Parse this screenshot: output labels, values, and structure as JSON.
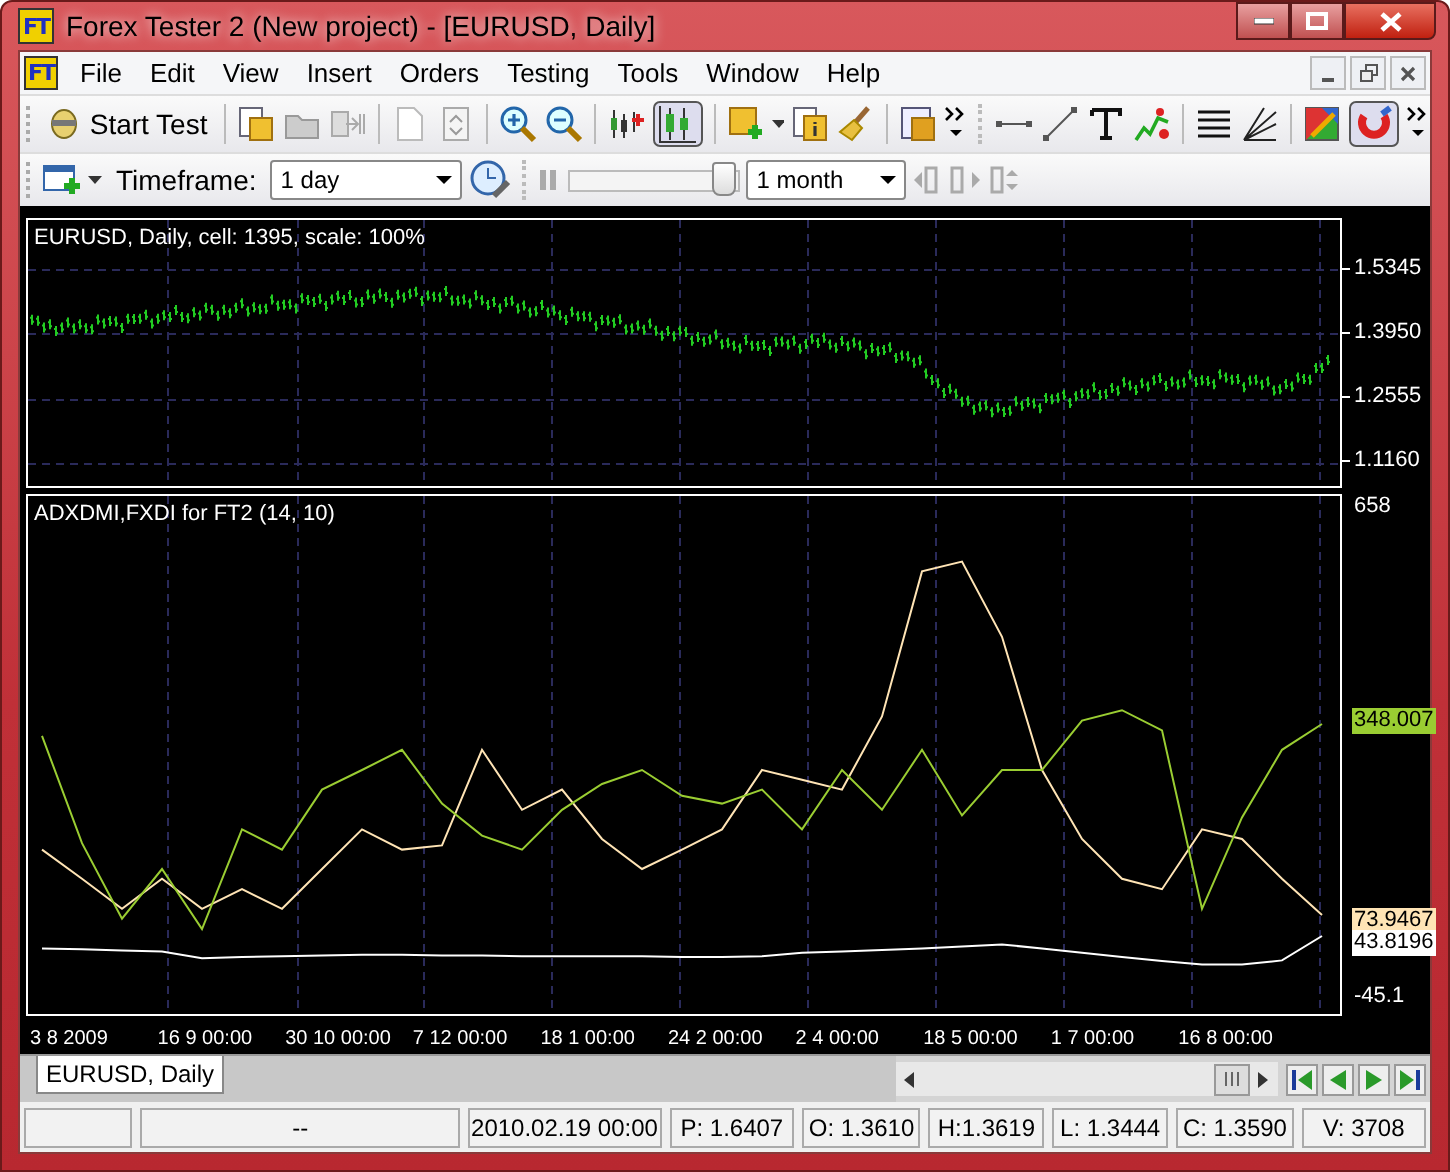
{
  "window": {
    "title": "Forex Tester 2  (New project) - [EURUSD, Daily]",
    "logo": "FT"
  },
  "menu_logo": "FT",
  "menu": [
    "File",
    "Edit",
    "View",
    "Insert",
    "Orders",
    "Testing",
    "Tools",
    "Window",
    "Help"
  ],
  "toolbar": {
    "start_test": "Start Test"
  },
  "timeframe_bar": {
    "label": "Timeframe:",
    "timeframe": "1 day",
    "speed": {
      "level": 0.97
    },
    "step": "1 month"
  },
  "price_chart": {
    "title": "EURUSD, Daily, cell: 1395, scale: 100%",
    "price_labels": [
      "1.5345",
      "1.3950",
      "1.2555",
      "1.1160"
    ]
  },
  "indicator_chart": {
    "title": "ADXDMI,FXDI for FT2 (14, 10)",
    "chart_data": {
      "type": "line",
      "ylim": [
        -67.9,
        675.1
      ],
      "yticks": [
        {
          "value": 658,
          "label": "658"
        },
        {
          "value": -45.1,
          "label": "-45.1"
        }
      ],
      "series": [
        {
          "color": "#9acd32",
          "values": [
            331,
            177,
            69,
            140,
            54,
            197,
            168,
            254,
            282,
            311,
            234,
            188,
            168,
            225,
            262,
            282,
            245,
            234,
            254,
            197,
            282,
            225,
            311,
            217,
            282,
            282,
            353,
            368,
            339,
            83,
            214,
            311,
            348
          ]
        },
        {
          "color": "#ffe4b5",
          "values": [
            168,
            126,
            83,
            126,
            83,
            111,
            83,
            140,
            197,
            168,
            174,
            311,
            225,
            254,
            183,
            140,
            168,
            197,
            282,
            268,
            254,
            359,
            567,
            581,
            473,
            282,
            183,
            126,
            111,
            197,
            183,
            126,
            74
          ]
        },
        {
          "color": "#ffffff",
          "values": [
            26,
            25,
            23,
            22,
            12,
            14,
            15,
            16,
            17,
            17,
            16,
            16,
            15,
            15,
            15,
            15,
            14,
            14,
            15,
            20,
            22,
            24,
            26,
            29,
            32,
            26,
            20,
            14,
            8,
            3,
            3,
            9,
            44
          ]
        }
      ]
    },
    "value_tags": [
      {
        "text": "348.007",
        "color": "#9acd32"
      },
      {
        "text": "73.9467",
        "color": "#ffe4b5"
      },
      {
        "text": "43.8196",
        "color": "#ffffff"
      }
    ]
  },
  "time_labels": [
    "3 8 2009",
    "16 9 00:00",
    "30 10 00:00",
    "7 12 00:00",
    "18 1 00:00",
    "24 2 00:00",
    "2 4 00:00",
    "18 5 00:00",
    "1 7 00:00",
    "16 8 00:00"
  ],
  "chart_tabs": [
    {
      "label": "EURUSD, Daily",
      "selected": true
    }
  ],
  "status_bar": [
    "--",
    "2010.02.19 00:00",
    "P: 1.6407",
    "O: 1.3610",
    "H:1.3619",
    "L: 1.3444",
    "C: 1.3590",
    "V: 3708"
  ]
}
